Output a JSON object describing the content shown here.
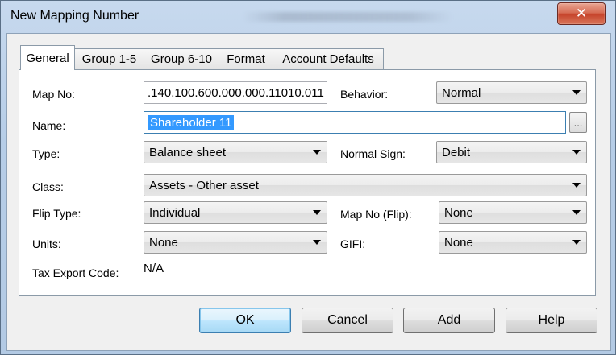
{
  "window": {
    "title": "New Mapping Number",
    "close_glyph": "✕"
  },
  "tabs": [
    {
      "label": "General",
      "active": true
    },
    {
      "label": "Group 1-5"
    },
    {
      "label": "Group 6-10"
    },
    {
      "label": "Format"
    },
    {
      "label": "Account Defaults"
    }
  ],
  "form": {
    "map_no": {
      "label": "Map No:",
      "value": ".140.100.600.000.000.11010.011"
    },
    "behavior": {
      "label": "Behavior:",
      "value": "Normal"
    },
    "name": {
      "label": "Name:",
      "value": "Shareholder 11",
      "browse": "..."
    },
    "type": {
      "label": "Type:",
      "value": "Balance sheet"
    },
    "normal_sign": {
      "label": "Normal Sign:",
      "value": "Debit"
    },
    "class": {
      "label": "Class:",
      "value": "Assets - Other asset"
    },
    "flip_type": {
      "label": "Flip Type:",
      "value": "Individual"
    },
    "map_no_flip": {
      "label": "Map No (Flip):",
      "value": "None"
    },
    "units": {
      "label": "Units:",
      "value": "None"
    },
    "gifi": {
      "label": "GIFI:",
      "value": "None"
    },
    "tax_export_code": {
      "label": "Tax Export Code:",
      "value": "N/A"
    }
  },
  "buttons": {
    "ok": "OK",
    "cancel": "Cancel",
    "add": "Add",
    "help": "Help"
  },
  "colors": {
    "selection": "#3399ff",
    "default_button_border": "#3c7fb1",
    "close_button": "#c6452c"
  }
}
